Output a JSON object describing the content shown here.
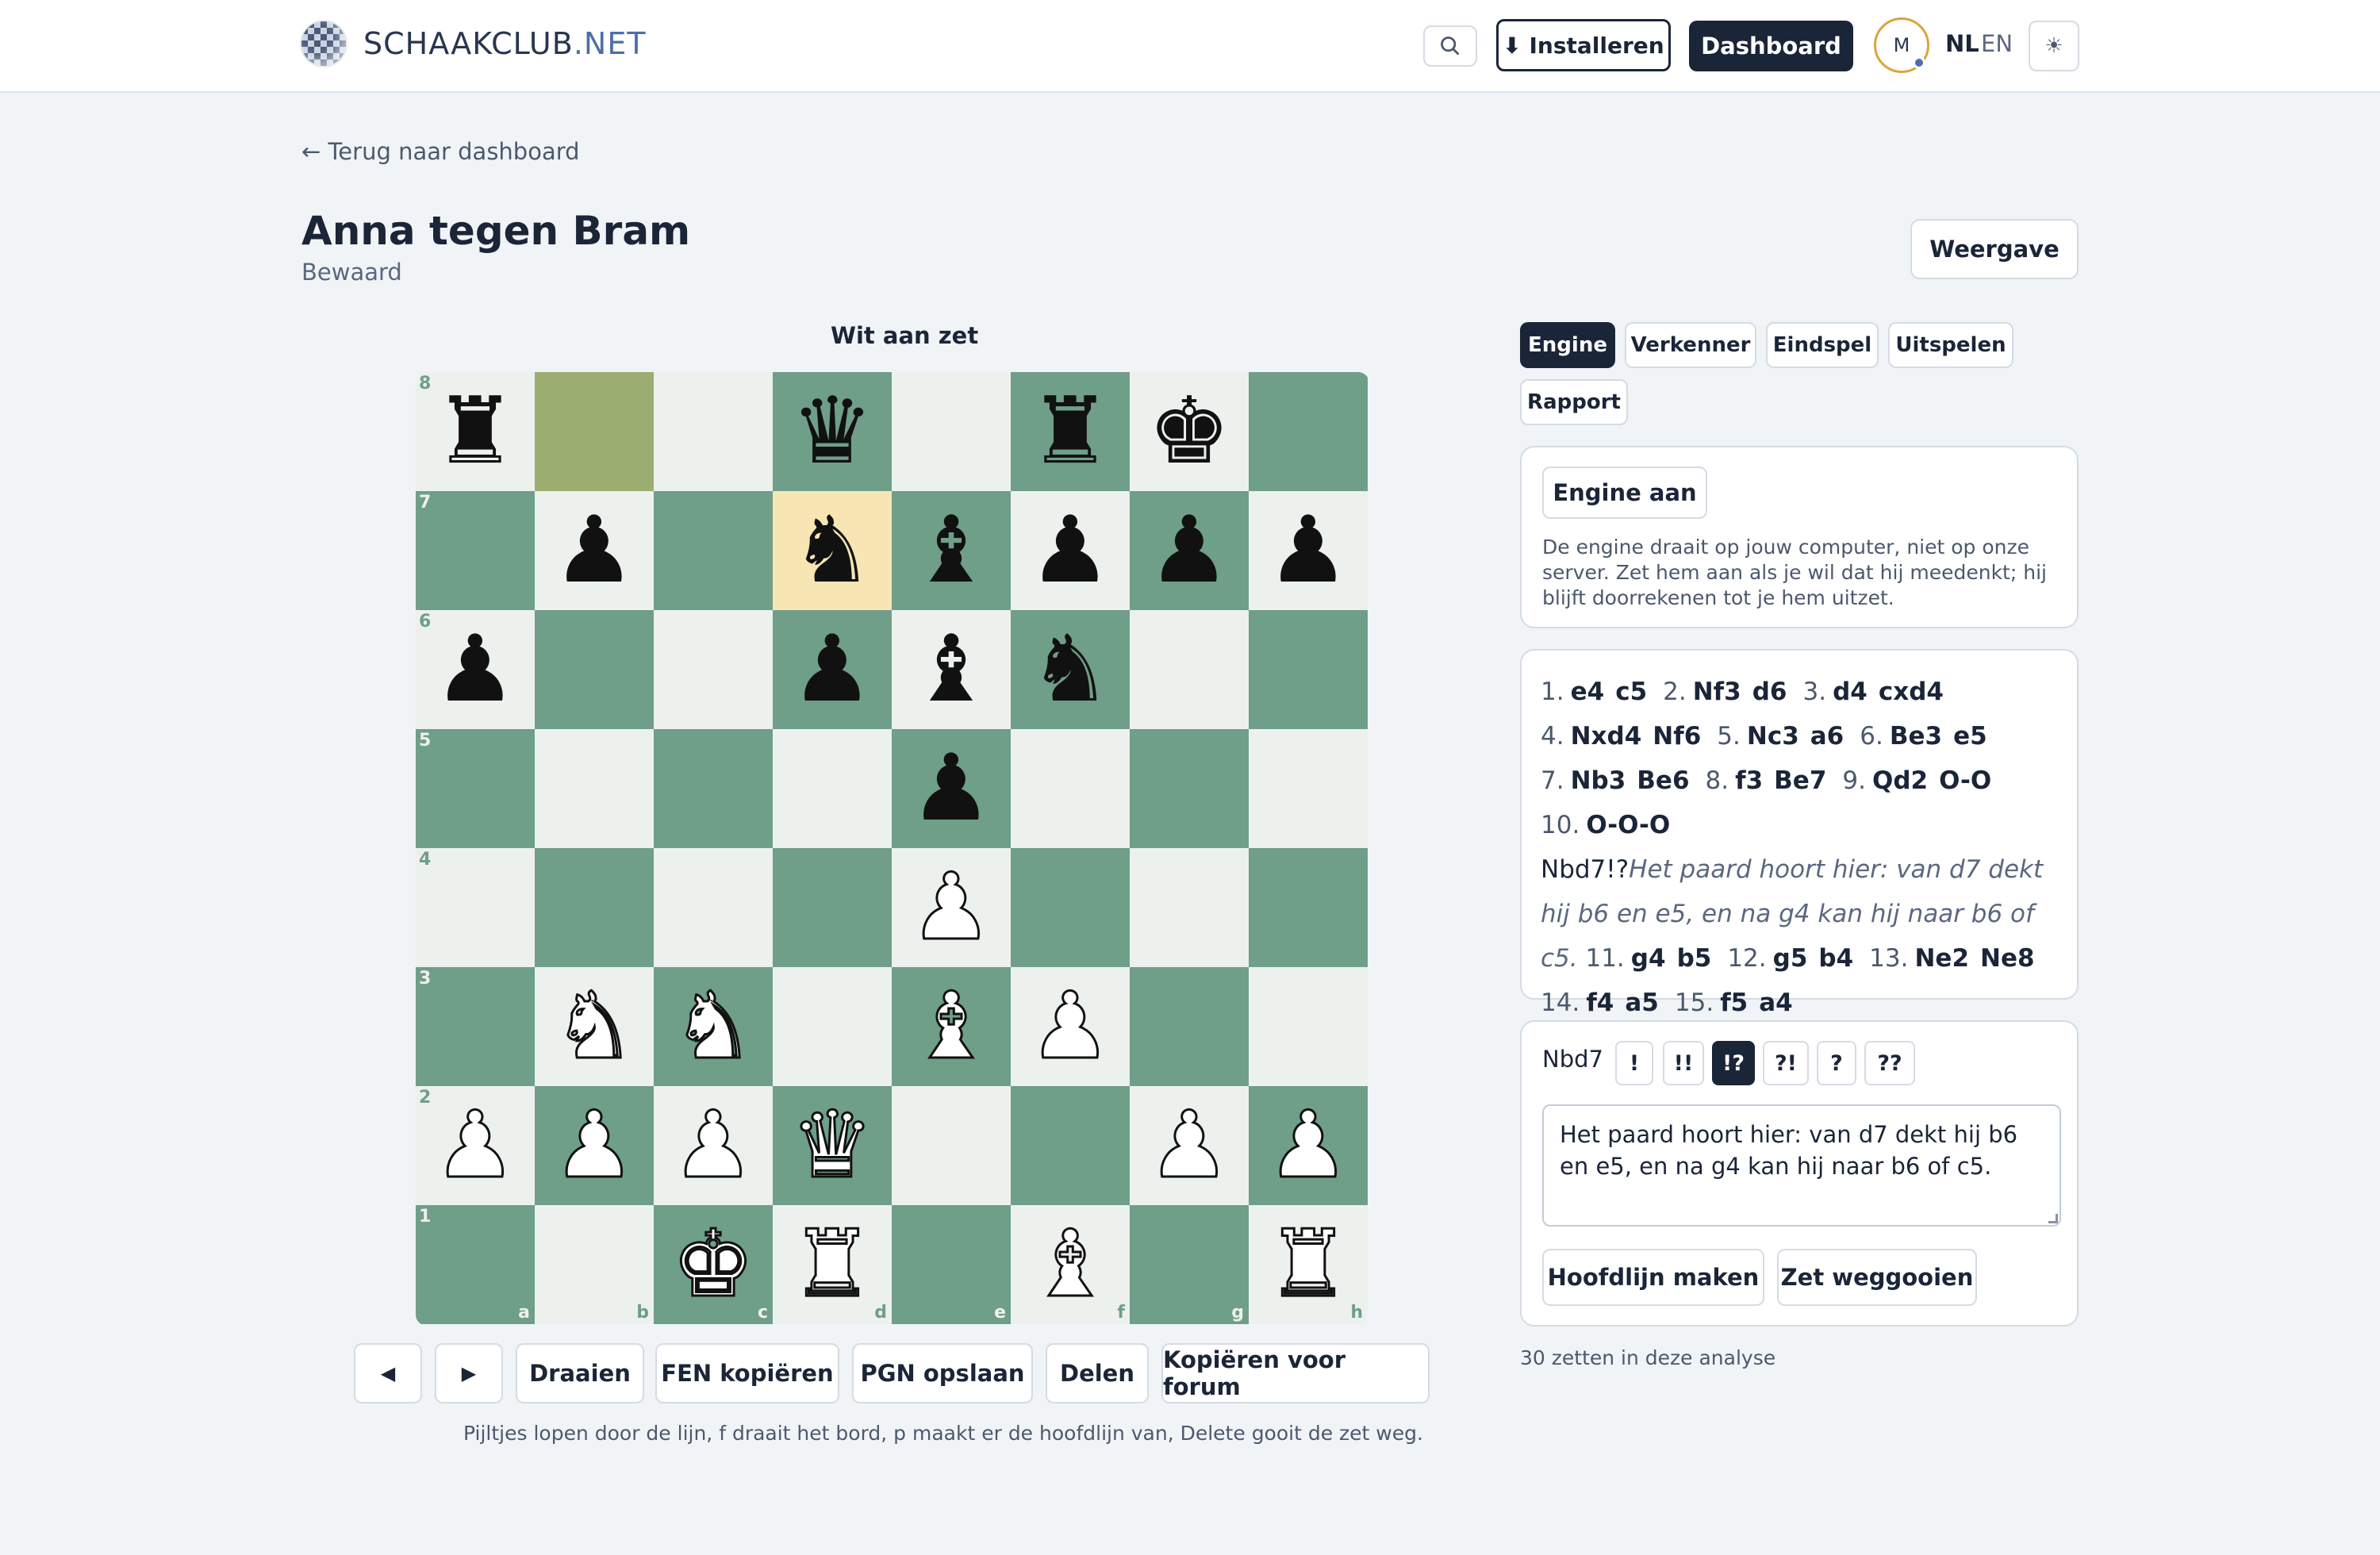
{
  "header": {
    "logo_main": "SCHAAKCLUB",
    "logo_ext": ".NET",
    "search_icon": "search-icon",
    "install_label": "⬇ Installeren",
    "dashboard_label": "Dashboard",
    "avatar_initial": "M",
    "lang_active": "NL",
    "lang_other": "EN",
    "theme_icon": "☀"
  },
  "page": {
    "back_link": "← Terug naar dashboard",
    "title": "Anna tegen Bram",
    "subtitle": "Bewaard",
    "view_button": "Weergave"
  },
  "board": {
    "turn_label": "Wit aan zet",
    "highlight_from": "b8",
    "highlight_to": "d7",
    "rank_labels": [
      "8",
      "7",
      "6",
      "5",
      "4",
      "3",
      "2",
      "1"
    ],
    "file_labels": [
      "a",
      "b",
      "c",
      "d",
      "e",
      "f",
      "g",
      "h"
    ],
    "ranks": [
      [
        "r",
        "",
        "",
        "q",
        "",
        "r",
        "k",
        ""
      ],
      [
        "",
        "p",
        "",
        "n",
        "b",
        "p",
        "p",
        "p"
      ],
      [
        "p",
        "",
        "",
        "p",
        "b",
        "n",
        "",
        ""
      ],
      [
        "",
        "",
        "",
        "",
        "p",
        "",
        "",
        ""
      ],
      [
        "",
        "",
        "",
        "",
        "P",
        "",
        "",
        ""
      ],
      [
        "",
        "N",
        "N",
        "",
        "B",
        "P",
        "",
        ""
      ],
      [
        "P",
        "P",
        "P",
        "Q",
        "",
        "",
        "P",
        "P"
      ],
      [
        "",
        "",
        "K",
        "R",
        "",
        "B",
        "",
        "R"
      ]
    ]
  },
  "controls": {
    "prev": "◀",
    "next": "▶",
    "flip": "Draaien",
    "copy_fen": "FEN kopiëren",
    "save_pgn": "PGN opslaan",
    "share": "Delen",
    "copy_forum": "Kopiëren voor forum",
    "hint": "Pijltjes lopen door de lijn, f draait het bord, p maakt er de hoofdlijn van, Delete gooit de zet weg."
  },
  "tabs": [
    {
      "label": "Engine",
      "active": true
    },
    {
      "label": "Verkenner",
      "active": false
    },
    {
      "label": "Eindspel",
      "active": false
    },
    {
      "label": "Uitspelen",
      "active": false
    },
    {
      "label": "Rapport",
      "active": false
    }
  ],
  "engine": {
    "button": "Engine aan",
    "description": "De engine draait op jouw computer, niet op onze server. Zet hem aan als je wil dat hij meedenkt; hij blijft doorrekenen tot je hem uitzet."
  },
  "moves": [
    {
      "num": "1.",
      "white": "e4",
      "black": "c5"
    },
    {
      "num": "2.",
      "white": "Nf3",
      "black": "d6"
    },
    {
      "num": "3.",
      "white": "d4",
      "black": "cxd4"
    },
    {
      "num": "4.",
      "white": "Nxd4",
      "black": "Nf6"
    },
    {
      "num": "5.",
      "white": "Nc3",
      "black": "a6"
    },
    {
      "num": "6.",
      "white": "Be3",
      "black": "e5"
    },
    {
      "num": "7.",
      "white": "Nb3",
      "black": "Be6"
    },
    {
      "num": "8.",
      "white": "f3",
      "black": "Be7"
    },
    {
      "num": "9.",
      "white": "Qd2",
      "black": "O-O"
    },
    {
      "num": "10.",
      "white": "O-O-O",
      "black": "Nbd7!?",
      "black_selected": true,
      "comment": "Het paard hoort hier: van d7 dekt hij b6 en e5, en na g4 kan hij naar b6 of c5."
    },
    {
      "num": "11.",
      "white": "g4",
      "black": "b5"
    },
    {
      "num": "12.",
      "white": "g5",
      "black": "b4"
    },
    {
      "num": "13.",
      "white": "Ne2",
      "black": "Ne8"
    },
    {
      "num": "14.",
      "white": "f4",
      "black": "a5"
    },
    {
      "num": "15.",
      "white": "f5",
      "black": "a4"
    }
  ],
  "annotation": {
    "move": "Nbd7",
    "symbols": [
      "!",
      "!!",
      "!?",
      "?!",
      "?",
      "??"
    ],
    "active_symbol": "!?",
    "comment": "Het paard hoort hier: van d7 dekt hij b6 en e5, en na g4 kan hij naar b6 of c5.",
    "make_mainline": "Hoofdlijn maken",
    "delete_move": "Zet weggooien"
  },
  "footer_note": "30 zetten in deze analyse"
}
